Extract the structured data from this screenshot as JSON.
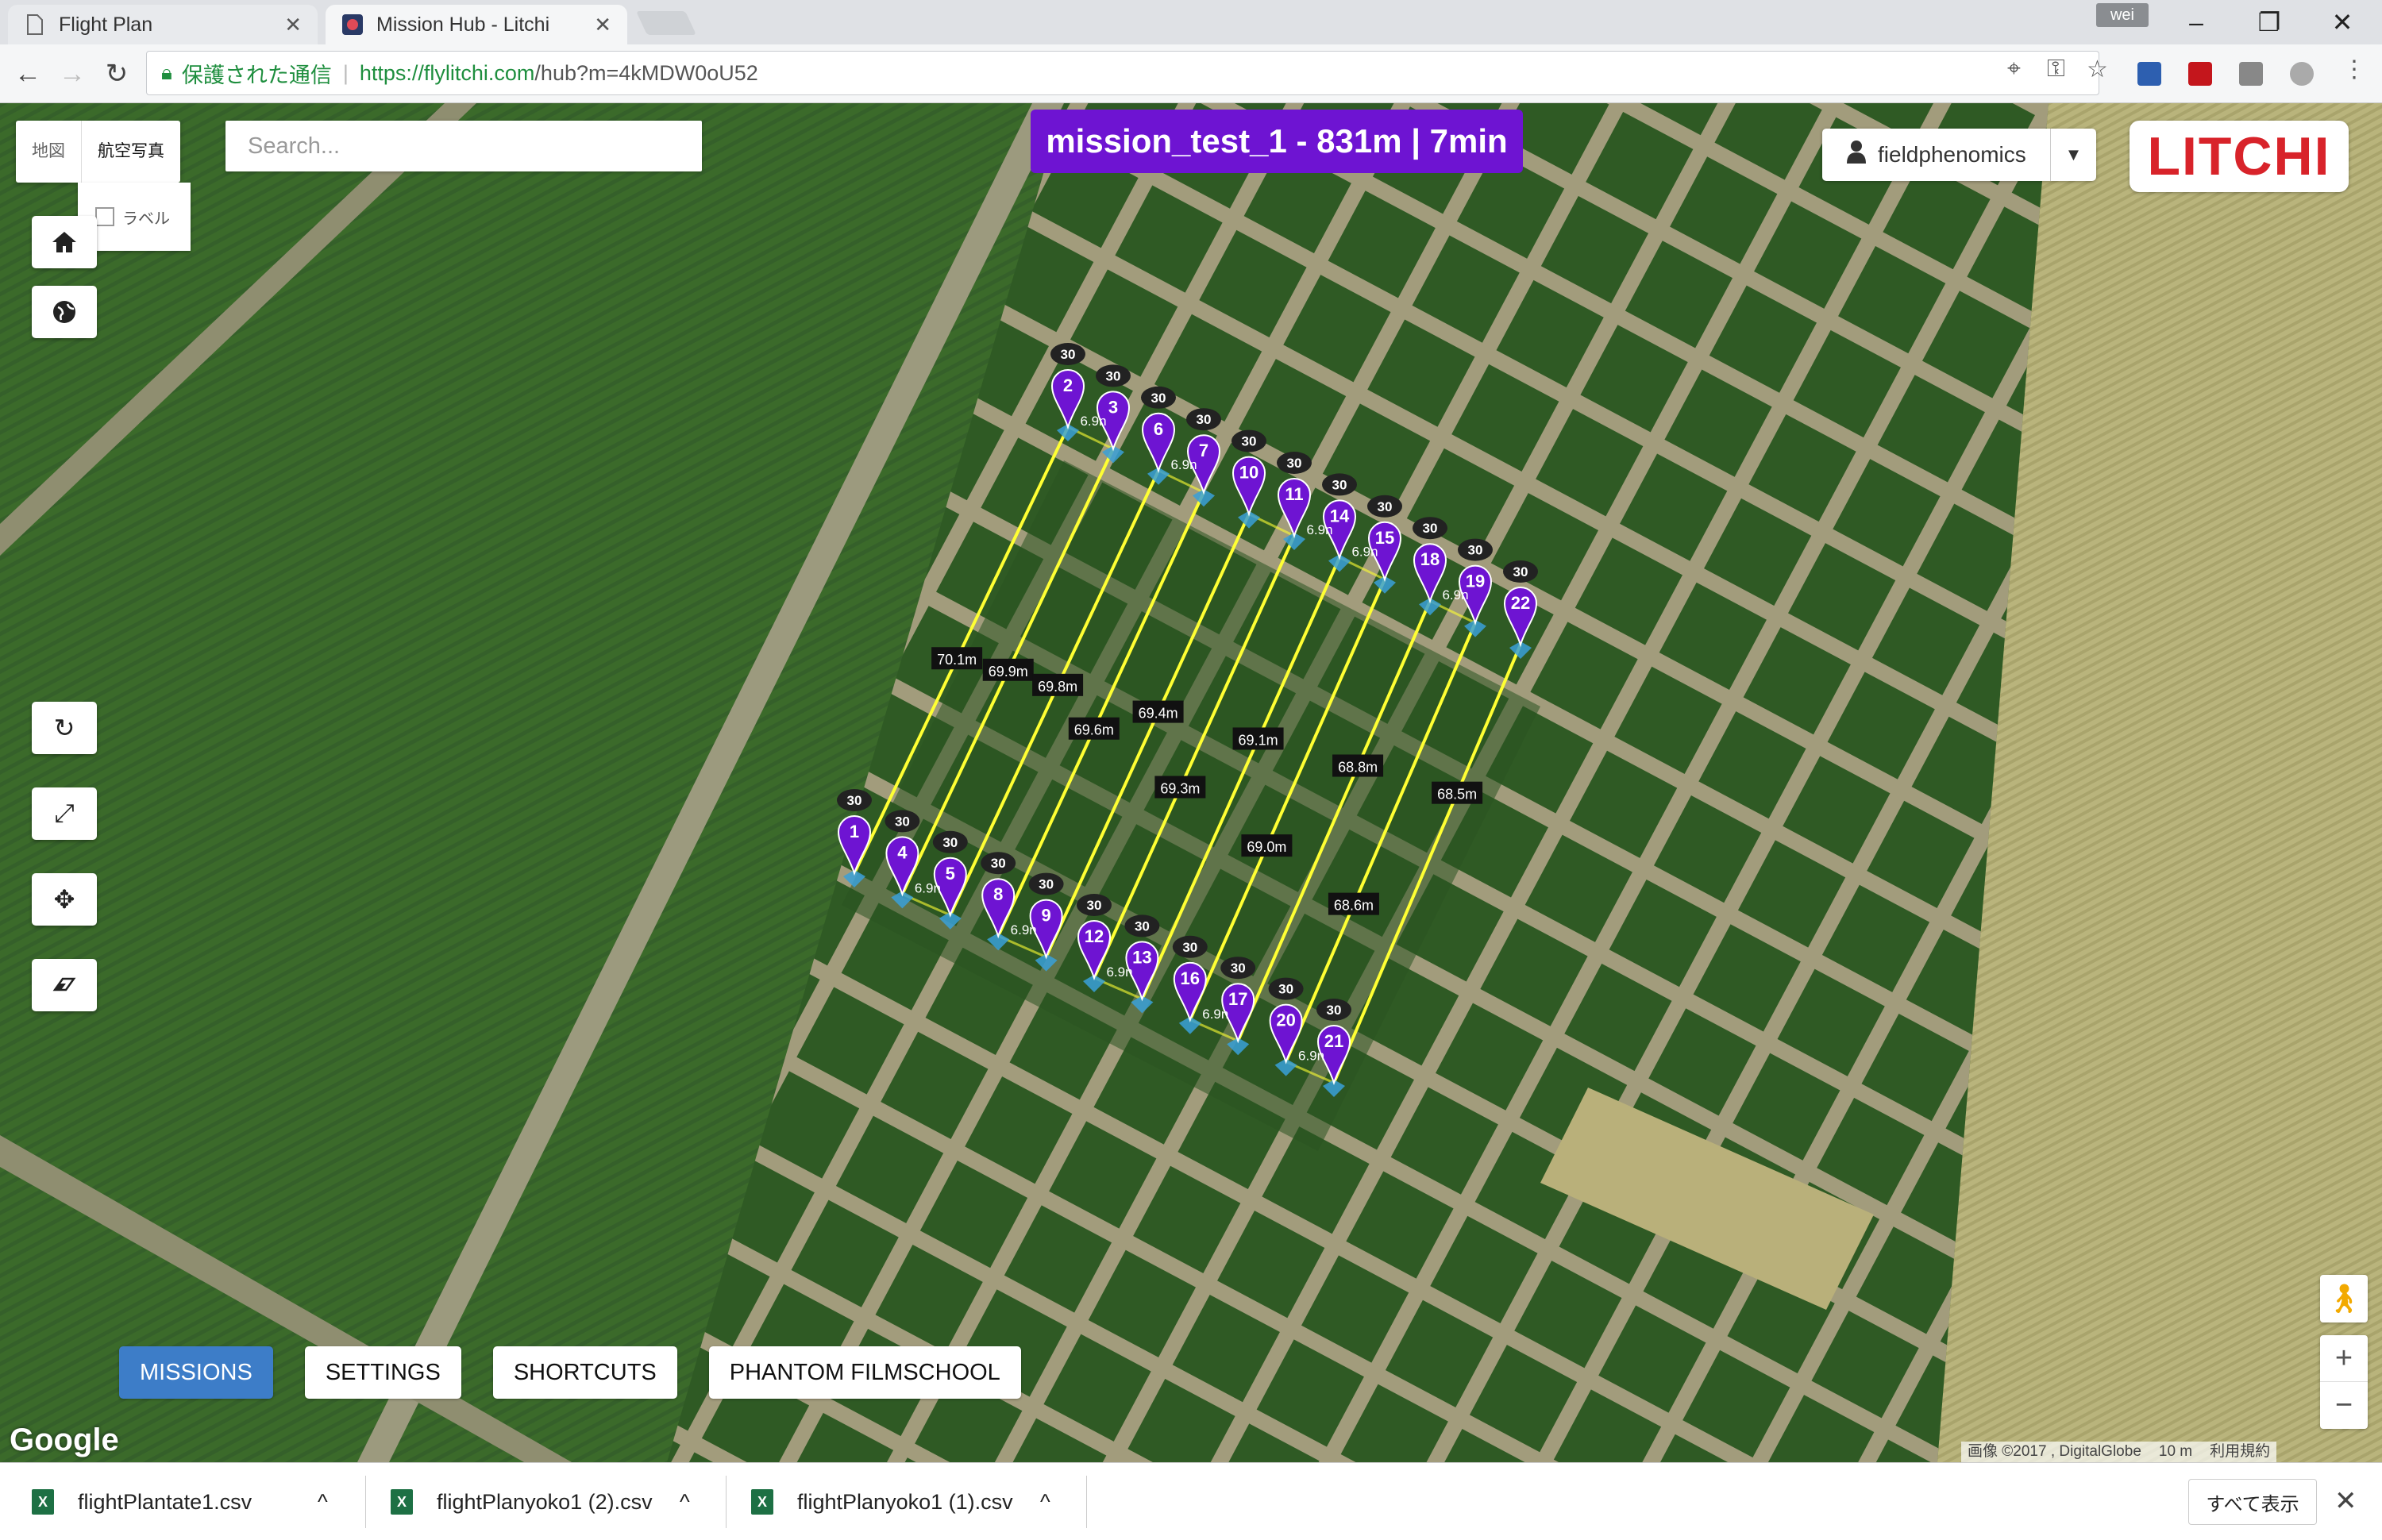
{
  "browser": {
    "tabs": [
      {
        "title": "Flight Plan",
        "icon": "page-icon"
      },
      {
        "title": "Mission Hub - Litchi",
        "icon": "litchi-favicon"
      }
    ],
    "profile": "wei",
    "secure_label": "保護された通信",
    "url_host": "https://flylitchi.com",
    "url_rest": "/hub?m=4kMDW0oU52"
  },
  "map": {
    "maptype_options": [
      "地図",
      "航空写真"
    ],
    "selected_maptype": "航空写真",
    "label_option": "ラベル",
    "search_placeholder": "Search...",
    "google_logo": "Google",
    "attribution": "画像 ©2017 , DigitalGlobe",
    "scale": "10 m",
    "terms": "利用規約"
  },
  "mission": {
    "title": "mission_test_1 - 831m | 7min",
    "altitude_label": "30",
    "height_label": "6.9n",
    "leg_distances": [
      "70.1m",
      "69.9m",
      "69.8m",
      "69.6m",
      "69.4m",
      "69.3m",
      "69.1m",
      "69.0m",
      "68.8m",
      "68.6m",
      "68.5m"
    ],
    "waypoints": [
      {
        "n": "1"
      },
      {
        "n": "2"
      },
      {
        "n": "3"
      },
      {
        "n": "4"
      },
      {
        "n": "5"
      },
      {
        "n": "6"
      },
      {
        "n": "7"
      },
      {
        "n": "8"
      },
      {
        "n": "9"
      },
      {
        "n": "10"
      },
      {
        "n": "11"
      },
      {
        "n": "12"
      },
      {
        "n": "13"
      },
      {
        "n": "14"
      },
      {
        "n": "15"
      },
      {
        "n": "16"
      },
      {
        "n": "17"
      },
      {
        "n": "18"
      },
      {
        "n": "19"
      },
      {
        "n": "20"
      },
      {
        "n": "21"
      },
      {
        "n": "22"
      }
    ],
    "colors": {
      "marker": "#6e14d2",
      "path": "#ffff33",
      "banner": "#6e14d2"
    }
  },
  "user": {
    "name": "fieldphenomics"
  },
  "logo": "LITCHI",
  "nav_buttons": [
    "MISSIONS",
    "SETTINGS",
    "SHORTCUTS",
    "PHANTOM FILMSCHOOL"
  ],
  "active_nav": "MISSIONS",
  "downloads": [
    {
      "file": "flightPlantate1.csv"
    },
    {
      "file": "flightPlanyoko1 (2).csv"
    },
    {
      "file": "flightPlanyoko1 (1).csv"
    }
  ],
  "show_all": "すべて表示"
}
